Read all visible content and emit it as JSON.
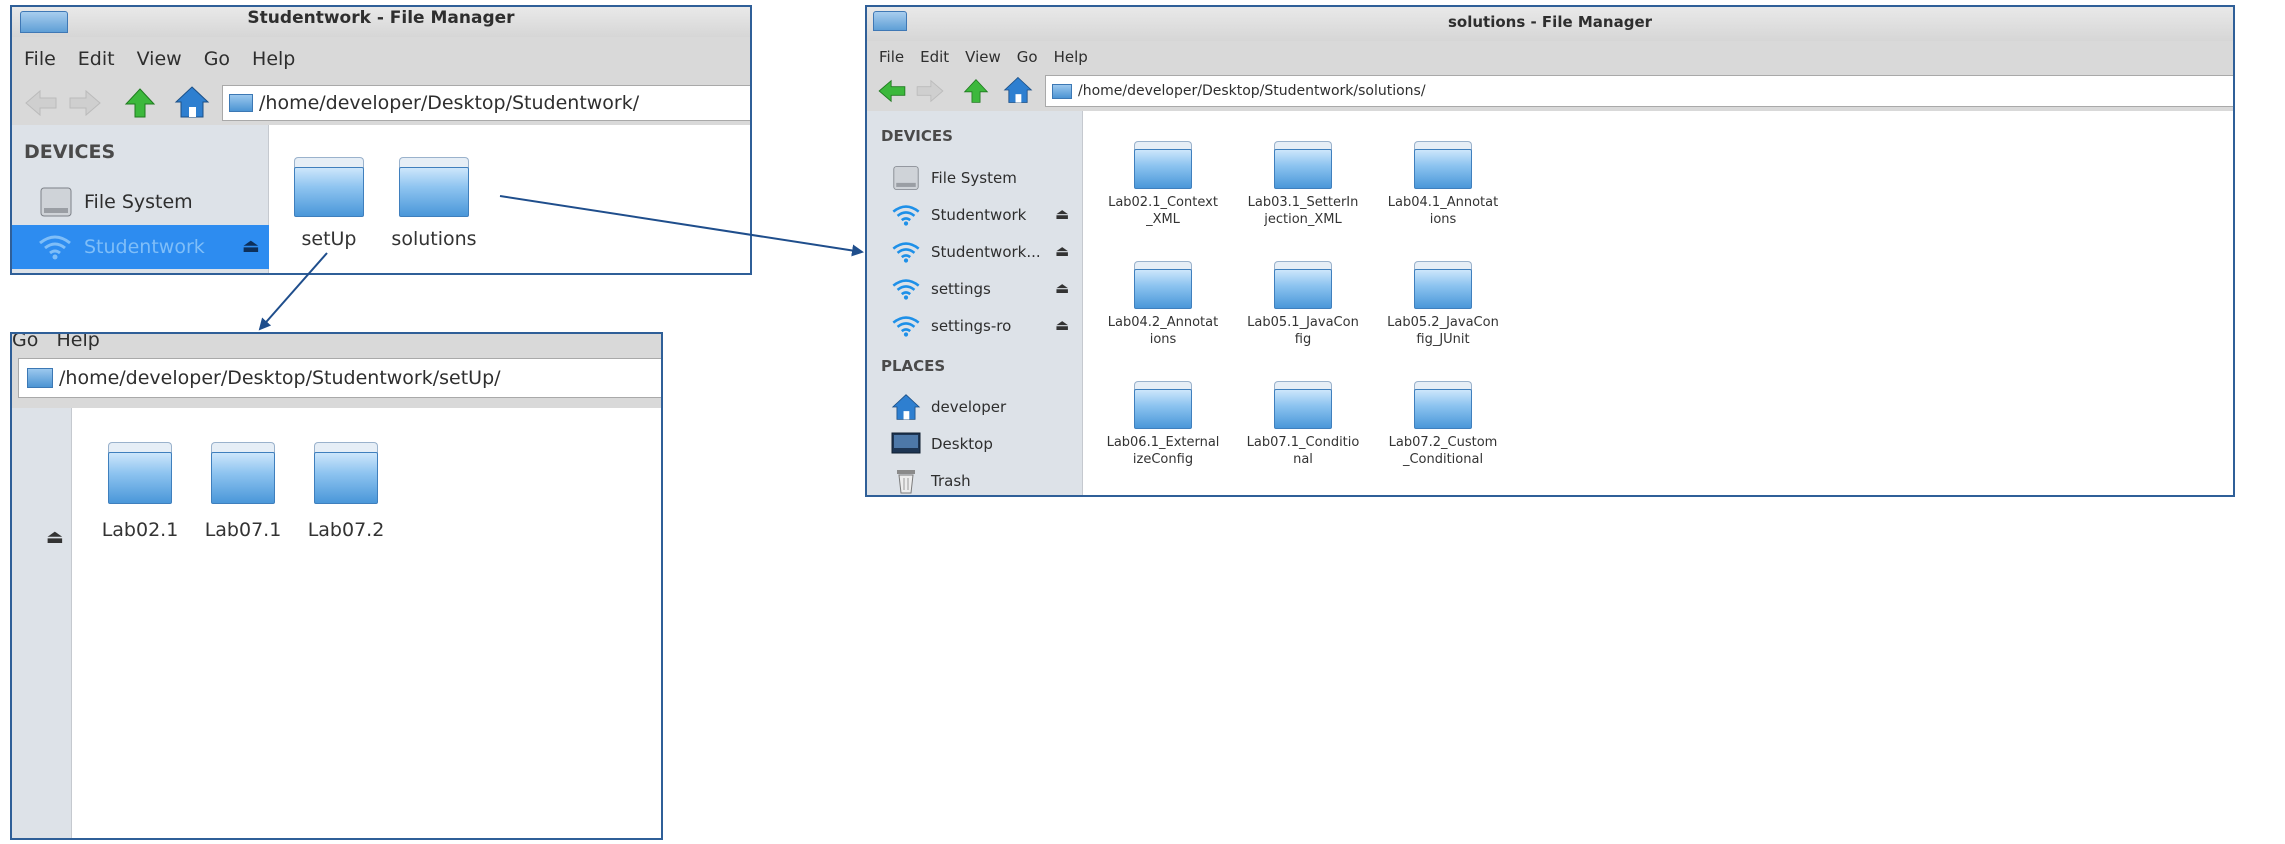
{
  "windows": {
    "studentwork": {
      "title": "Studentwork - File Manager",
      "menu": [
        "File",
        "Edit",
        "View",
        "Go",
        "Help"
      ],
      "path": "/home/developer/Desktop/Studentwork/",
      "sidebar": {
        "devices_header": "DEVICES",
        "file_system": "File System",
        "selected_item": "Studentwork",
        "eject": "⏏"
      },
      "folders": [
        "setUp",
        "solutions"
      ]
    },
    "setup": {
      "menu_partial": "Go   Help",
      "path": "/home/developer/Desktop/Studentwork/setUp/",
      "eject": "⏏",
      "folders": [
        "Lab02.1",
        "Lab07.1",
        "Lab07.2"
      ]
    },
    "solutions": {
      "title": "solutions - File Manager",
      "menu": [
        "File",
        "Edit",
        "View",
        "Go",
        "Help"
      ],
      "path": "/home/developer/Desktop/Studentwork/solutions/",
      "sidebar": {
        "devices_header": "DEVICES",
        "devices": [
          "File System",
          "Studentwork",
          "Studentwork...",
          "settings",
          "settings-ro"
        ],
        "places_header": "PLACES",
        "places": [
          "developer",
          "Desktop",
          "Trash"
        ],
        "eject": "⏏"
      },
      "folders": [
        [
          "Lab02.1_Context",
          "_XML"
        ],
        [
          "Lab03.1_SetterIn",
          "jection_XML"
        ],
        [
          "Lab04.1_Annotat",
          "ions"
        ],
        [
          "Lab04.2_Annotat",
          "ions"
        ],
        [
          "Lab05.1_JavaCon",
          "fig"
        ],
        [
          "Lab05.2_JavaCon",
          "fig_JUnit"
        ],
        [
          "Lab06.1_External",
          "izeConfig"
        ],
        [
          "Lab07.1_Conditio",
          "nal"
        ],
        [
          "Lab07.2_Custom",
          "_Conditional"
        ]
      ]
    }
  },
  "colors": {
    "frame_border": "#2f5f98",
    "arrow": "#1f4e8c",
    "selection": "#2d8cf0",
    "folder_blue": "#4a97d9"
  }
}
